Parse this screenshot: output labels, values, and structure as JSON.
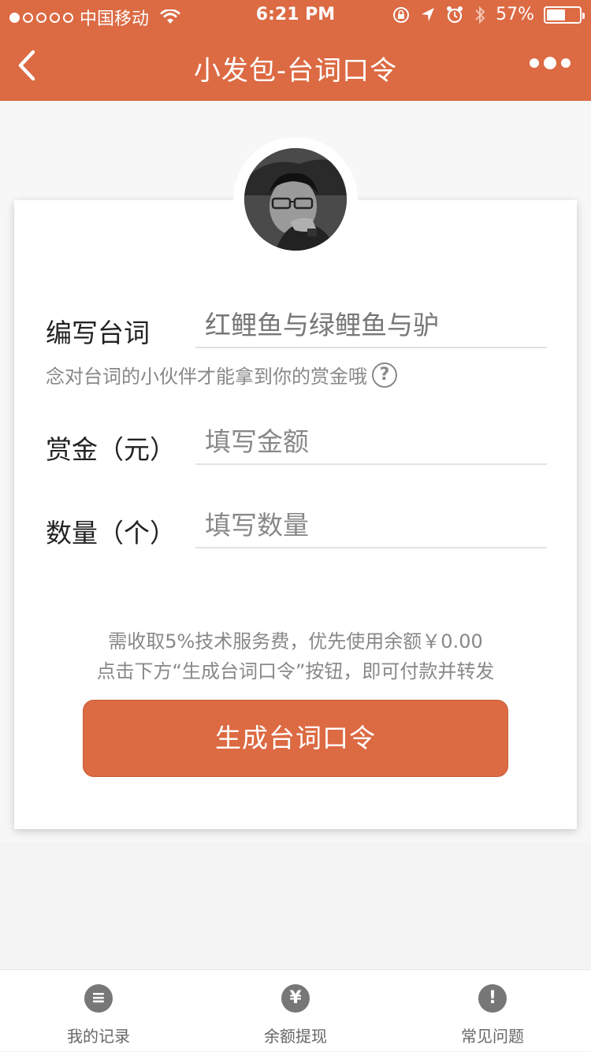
{
  "status_bar": {
    "carrier": "中国移动",
    "time": "6:21 PM",
    "battery": "57%",
    "signal_strength": 1,
    "battery_level": 0.57
  },
  "nav": {
    "title": "小发包-台词口令",
    "back_icon": "chevron-left-icon",
    "more_icon": "more-dots-icon"
  },
  "form": {
    "script": {
      "label": "编写台词",
      "value": "红鲤鱼与绿鲤鱼与驴"
    },
    "hint": "念对台词的小伙伴才能拿到你的赏金哦",
    "amount": {
      "label": "赏金（元）",
      "placeholder": "填写金额"
    },
    "count": {
      "label": "数量（个）",
      "placeholder": "填写数量"
    }
  },
  "notice": {
    "line1": "需收取5%技术服务费，优先使用余额￥0.00",
    "line2": "点击下方“生成台词口令”按钮，即可付款并转发"
  },
  "primary_button": "生成台词口令",
  "tabs": [
    {
      "label": "我的记录",
      "icon": "list-icon",
      "glyph": "≡"
    },
    {
      "label": "余额提现",
      "icon": "yen-icon",
      "glyph": "¥"
    },
    {
      "label": "常见问题",
      "icon": "exclamation-icon",
      "glyph": "!"
    }
  ],
  "colors": {
    "accent": "#dc6a43",
    "text_primary": "#222222",
    "text_secondary": "#888888"
  }
}
